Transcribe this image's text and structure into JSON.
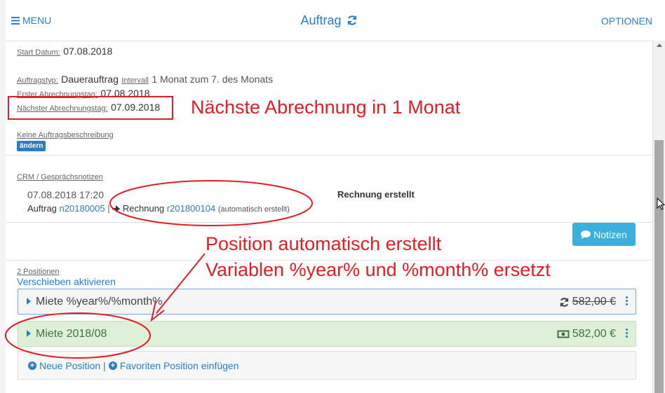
{
  "header": {
    "menu_label": "MENU",
    "title": "Auftrag",
    "options_label": "OPTIONEN"
  },
  "details": {
    "start_label": "Start Datum:",
    "start_value": "07.08.2018",
    "type_label": "Auftragstyp:",
    "type_value": "Dauerauftrag",
    "interval_label": "Intervall",
    "interval_value": "1 Monat zum 7. des Monats",
    "first_billing_label": "Erster Abrechnungstag:",
    "first_billing_value": "07.08.2018",
    "next_billing_label": "Nächster Abrechnungstag:",
    "next_billing_value": "07.09.2018",
    "description_label": "Keine Auftragsbeschreibung",
    "edit_button": "ändern"
  },
  "crm": {
    "label": "CRM / Gesprächsnotizen",
    "entry": {
      "timestamp": "07.08.2018 17:20",
      "title": "Rechnung erstellt",
      "order_prefix": "Auftrag",
      "order_link": "n20180005",
      "invoice_prefix": "Rechnung",
      "invoice_link": "r201800104",
      "note": "(automatisch erstellt)"
    },
    "notes_button": "Notizen"
  },
  "positions": {
    "count_label": "2 Positionen",
    "reorder_link": "Verschieben aktivieren",
    "items": [
      {
        "name": "Miete %year%/%month%",
        "price": "582,00 €",
        "price_icon": "refresh-icon",
        "strikethrough": true
      },
      {
        "name": "Miete 2018/08",
        "price": "582,00 €",
        "price_icon": "money-icon",
        "status_color": "#3c763d"
      }
    ],
    "add_position": "Neue Position",
    "add_favorite": "Favoriten Position einfügen"
  },
  "annotations": {
    "next_billing_note": "Nächste Abrechnung in 1 Monat",
    "position_note_line1": "Position automatisch erstellt",
    "position_note_line2": "Variablen %year% und %month% ersetzt"
  },
  "colors": {
    "accent": "#2a7ec8",
    "annotation": "#e51c23",
    "success_bg": "#dff0d8",
    "notes_button": "#3ab0de"
  }
}
